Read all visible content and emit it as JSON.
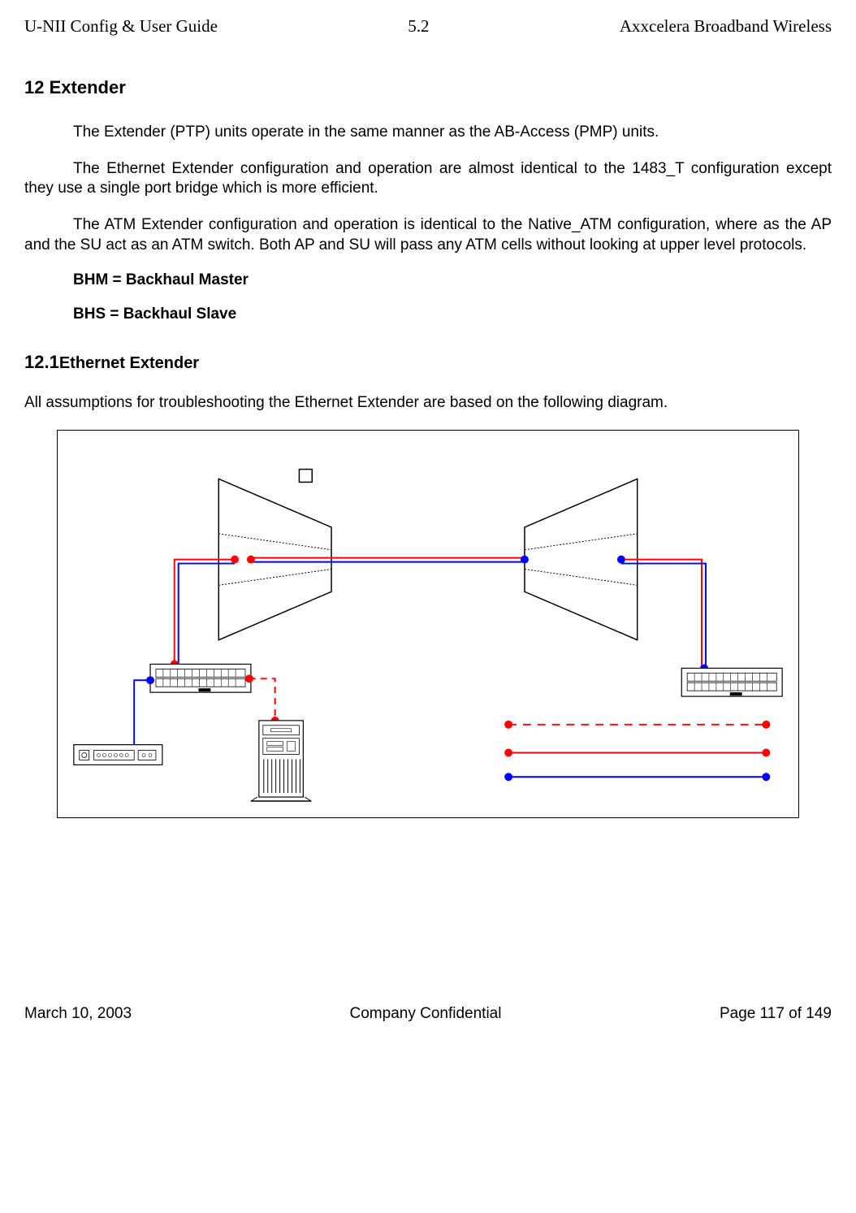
{
  "header": {
    "left": "U-NII Config & User Guide",
    "center": "5.2",
    "right": "Axxcelera Broadband Wireless"
  },
  "section": {
    "number": "12",
    "title": "Extender"
  },
  "paragraphs": {
    "p1": "The Extender (PTP) units operate in the same manner as the AB-Access (PMP) units.",
    "p2": "The Ethernet Extender configuration and operation are almost identical to the 1483_T configuration except they use a single port bridge which is more efficient.",
    "p3": "The ATM Extender configuration and operation is identical to the Native_ATM configuration, where as the AP and the SU act as an ATM switch. Both AP and SU will pass any ATM cells without looking at upper level protocols."
  },
  "definitions": {
    "bhm": "BHM = Backhaul Master",
    "bhs": "BHS = Backhaul Slave"
  },
  "subsection": {
    "number": "12.1",
    "title": "Ethernet Extender"
  },
  "caption": "All assumptions for troubleshooting the Ethernet Extender are based on the following diagram.",
  "footer": {
    "left": "March 10, 2003",
    "center": "Company Confidential",
    "right": "Page 117 of 149"
  }
}
